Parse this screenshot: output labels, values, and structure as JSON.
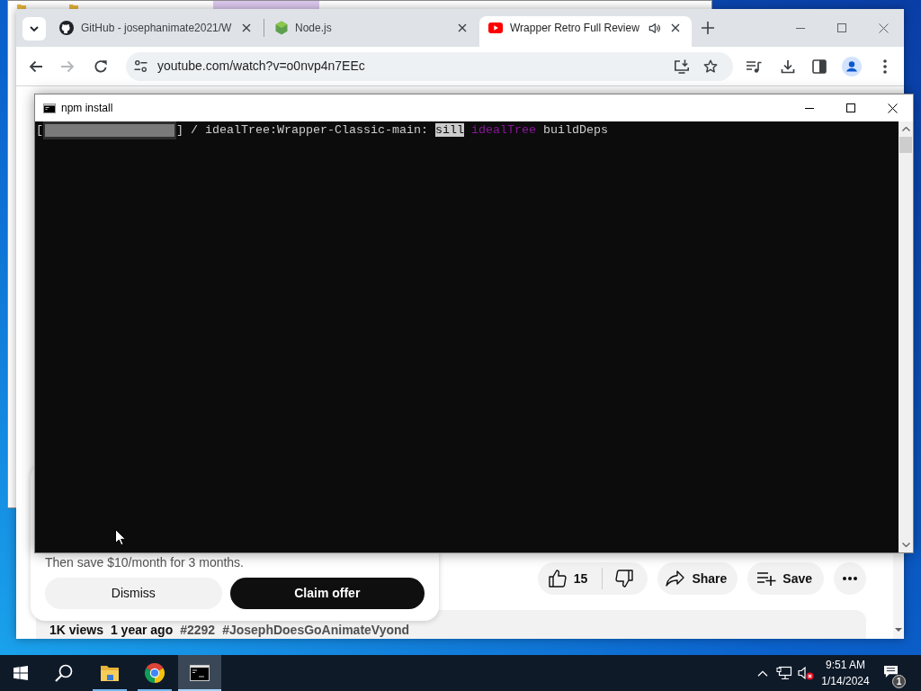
{
  "browser": {
    "tabs": [
      {
        "kind": "github",
        "label": "GitHub - josephanimate2021/W",
        "selected": false,
        "audio": false
      },
      {
        "kind": "nodejs",
        "label": "Node.js",
        "selected": false,
        "audio": false
      },
      {
        "kind": "youtube",
        "label": "Wrapper Retro Full Review",
        "selected": true,
        "audio": true
      }
    ],
    "forward_disabled": true,
    "address": "youtube.com/watch?v=o0nvp4n7EEc",
    "page": {
      "promo": {
        "text": "Then save $10/month for 3 months.",
        "buttons": [
          {
            "kind": "secondary",
            "label": "Dismiss"
          },
          {
            "kind": "primary",
            "label": "Claim offer"
          }
        ]
      },
      "actions": {
        "likes": "15",
        "share": "Share",
        "save": "Save"
      },
      "description": [
        {
          "kind": "meta",
          "text": "1K views"
        },
        {
          "kind": "meta",
          "text": "1 year ago"
        },
        {
          "kind": "hashtag",
          "text": "#2292"
        },
        {
          "kind": "hashtag",
          "text": "#JosephDoesGoAnimateVyond"
        }
      ]
    }
  },
  "console": {
    "title": "npm install",
    "progress": {
      "open": "[",
      "close": "]",
      "level": 1
    },
    "segments": [
      {
        "kind": "plain",
        "text": "/ idealTree:Wrapper-Classic-main:"
      },
      {
        "kind": "inverse",
        "text": "sill"
      },
      {
        "kind": "magenta",
        "text": "idealTree"
      },
      {
        "kind": "plain",
        "text": "buildDeps"
      }
    ]
  },
  "taskbar": {
    "apps": [
      {
        "kind": "explorer",
        "running": true,
        "selected": false
      },
      {
        "kind": "browser",
        "running": true,
        "selected": false
      },
      {
        "kind": "terminal",
        "running": true,
        "selected": true
      }
    ],
    "volume_muted": true,
    "clock": {
      "time": "9:51 AM",
      "date": "1/14/2024"
    },
    "notification_count": "1"
  }
}
